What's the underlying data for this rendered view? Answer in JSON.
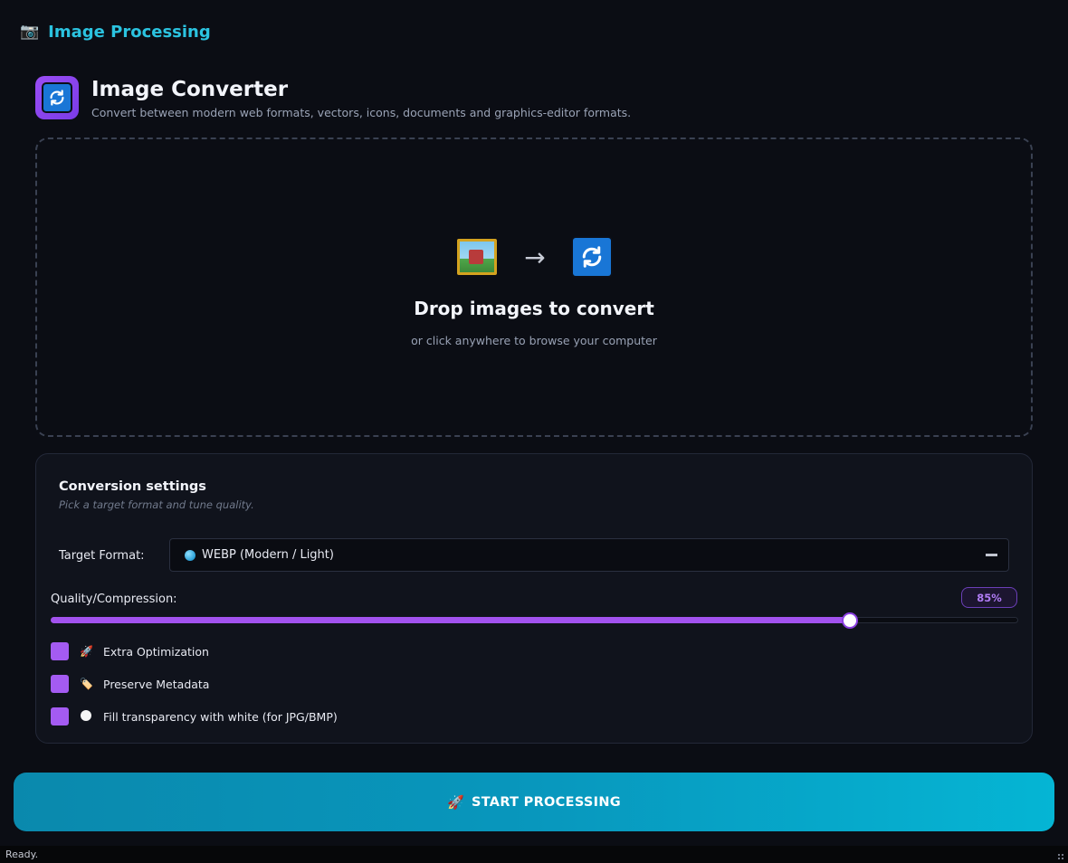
{
  "app": {
    "title": "Image Processing",
    "title_icon": "camera-icon"
  },
  "header": {
    "title": "Image Converter",
    "subtitle": "Convert between modern web formats, vectors, icons, documents and graphics-editor formats.",
    "icon": "sync-icon"
  },
  "dropzone": {
    "title": "Drop images to convert",
    "subtitle": "or click anywhere to browse your computer",
    "icons": [
      "picture-icon",
      "arrow-right-icon",
      "sync-icon"
    ],
    "arrow": "→"
  },
  "settings": {
    "title": "Conversion settings",
    "subtitle": "Pick a target format and tune quality.",
    "format_label": "Target Format:",
    "format_value": "WEBP (Modern / Light)",
    "quality_label": "Quality/Compression:",
    "quality_value": 85,
    "quality_display": "85%",
    "options": [
      {
        "label": "Extra Optimization",
        "icon": "rocket-icon",
        "emoji": "🚀"
      },
      {
        "label": "Preserve Metadata",
        "icon": "tag-icon",
        "emoji": "🏷️"
      },
      {
        "label": "Fill transparency with white (for JPG/BMP)",
        "icon": "white-circle-icon"
      }
    ]
  },
  "start_button": {
    "label": "START PROCESSING",
    "emoji": "🚀"
  },
  "status": {
    "text": "Ready."
  },
  "colors": {
    "accent_purple": "#a252ee",
    "accent_cyan": "#2bc3e0",
    "background": "#0b0d14"
  }
}
